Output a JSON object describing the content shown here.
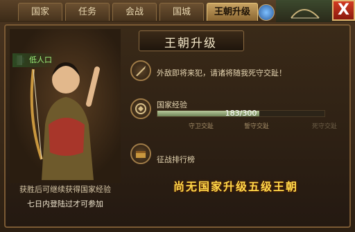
{
  "tabs": [
    {
      "label": "国家",
      "active": false
    },
    {
      "label": "任务",
      "active": false
    },
    {
      "label": "会战",
      "active": false
    },
    {
      "label": "国城",
      "active": false
    },
    {
      "label": "王朝升级",
      "active": true
    }
  ],
  "close_label": "X",
  "panel_title": "王朝升级",
  "portrait": {
    "population_label": "低人口",
    "caption_line1": "获胜后可继续获得国家经验",
    "caption_line2": "七日内登陆过才可参加"
  },
  "foreign_threat_text": "外敌即将来犯，请诸将随我死守交趾！",
  "national_exp": {
    "label": "国家经验",
    "current": 183,
    "max": 300,
    "display": "183/300",
    "milestones": [
      "守卫交趾",
      "誓守交趾",
      "死守交趾"
    ]
  },
  "ranking_label": "征战排行榜",
  "notice_text": "尚无国家升级五级王朝"
}
